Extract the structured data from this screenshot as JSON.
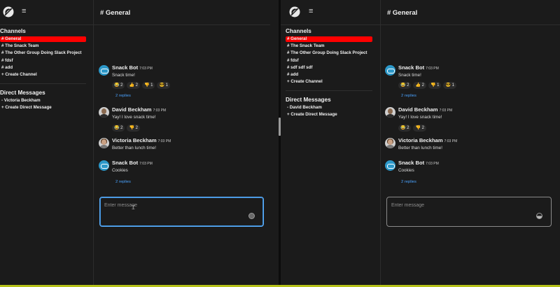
{
  "channel_header": "# General",
  "sidebar": {
    "channels_title": "Channels",
    "direct_title": "Direct Messages"
  },
  "left": {
    "channels": [
      "# General",
      "# The Snack Team",
      "# The Other Group Doing Slack Project",
      "# fdsf",
      "# add",
      "+ Create Channel"
    ],
    "dms": [
      "- Victoria Beckham",
      "+ Create Direct Message"
    ]
  },
  "right": {
    "channels": [
      "# General",
      "# The Snack Team",
      "# The Other Group Doing Slack Project",
      "# fdsf",
      "# sdf sdf sdf",
      "# add",
      "+ Create Channel"
    ],
    "dms": [
      "- David Beckham",
      "+ Create Direct Message"
    ]
  },
  "messages": [
    {
      "author": "Snack Bot",
      "time": "7:03 PM",
      "text": "Snack time!",
      "reactions": [
        "😂 2",
        "👍 2",
        "👎 1",
        "😎 1"
      ],
      "replies": "2 replies"
    },
    {
      "author": "David Beckham",
      "time": "7:03 PM",
      "text": "Yay! I love snack time!",
      "reactions": [
        "😂 2",
        "👎 2"
      ]
    },
    {
      "author": "Victoria Beckham",
      "time": "7:03 PM",
      "text": "Better than lunch time!"
    },
    {
      "author": "Snack Bot",
      "time": "7:03 PM",
      "text": "Cookies",
      "replies": "2 replies"
    }
  ],
  "composer": {
    "placeholder": "Enter message"
  },
  "colors": {
    "active_channel": "#ff0000",
    "link": "#4aa3ff",
    "focus": "#5ab0ff"
  }
}
